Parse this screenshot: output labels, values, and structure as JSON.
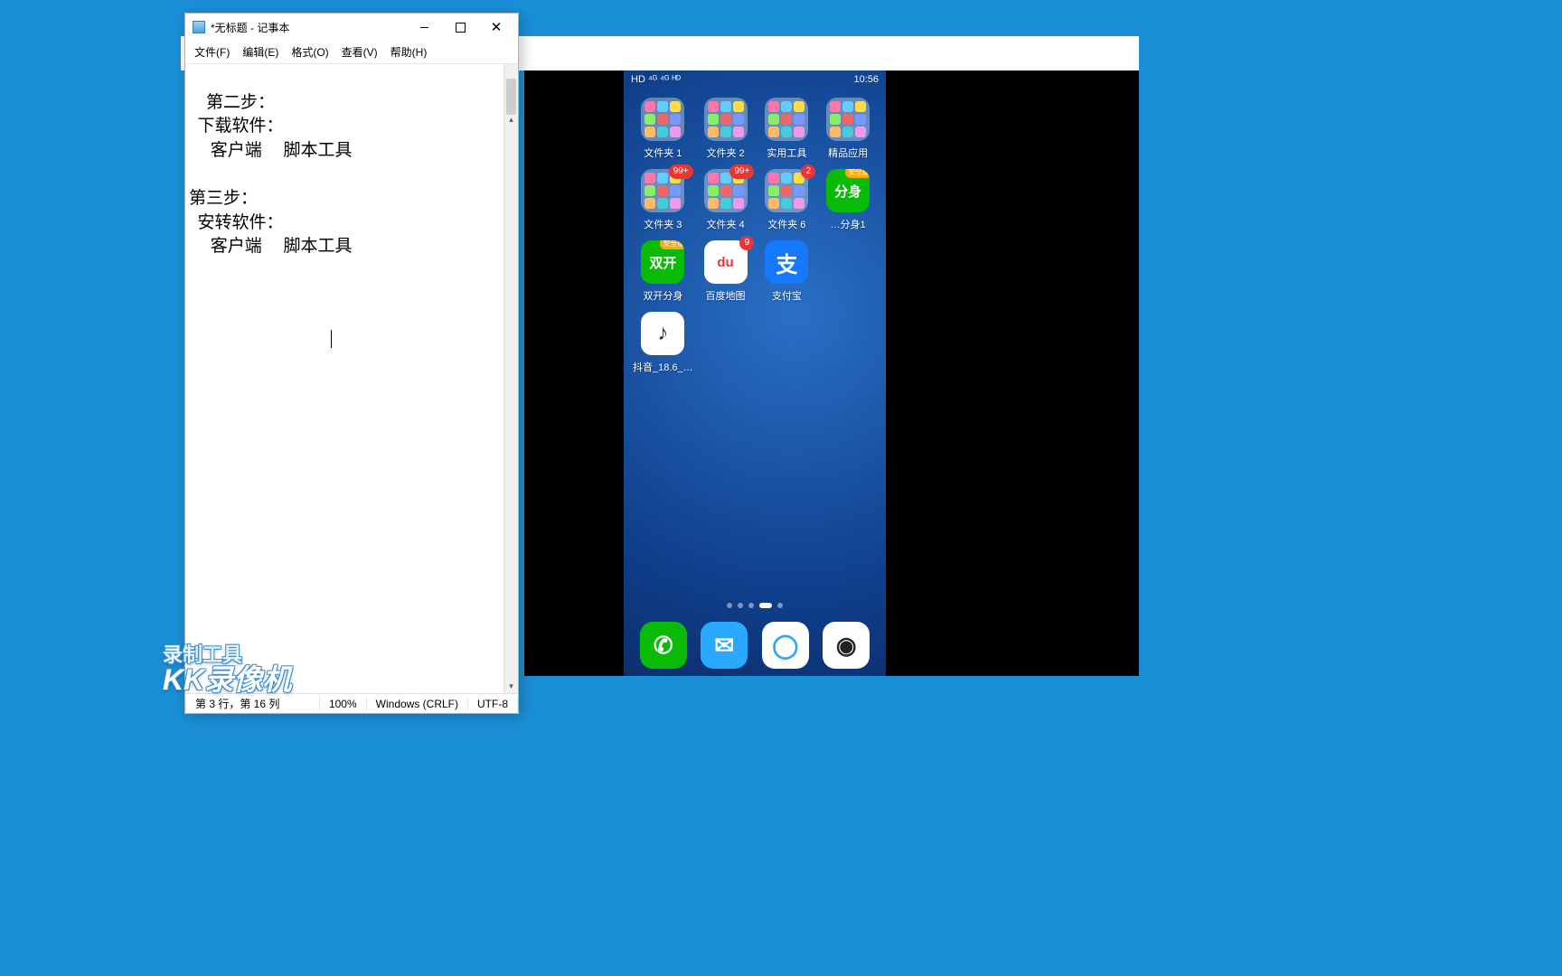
{
  "notepad": {
    "title": "*无标题 - 记事本",
    "menu": [
      "文件(F)",
      "编辑(E)",
      "格式(O)",
      "查看(V)",
      "帮助(H)"
    ],
    "content": "第二步：\n  下载软件：\n     客户端     脚本工具\n\n第三步：\n  安转软件：\n     客户端     脚本工具",
    "status": {
      "pos": "第 3 行，第 16 列",
      "zoom": "100%",
      "eol": "Windows (CRLF)",
      "enc": "UTF-8"
    }
  },
  "phone": {
    "status_left": "HD ⁴ᴳ ⁴ᴳ ᴴᴰ",
    "status_right": "10:56",
    "apps_row1": [
      {
        "label": "文件夹 1",
        "type": "folder"
      },
      {
        "label": "文件夹 2",
        "type": "folder"
      },
      {
        "label": "实用工具",
        "type": "folder"
      },
      {
        "label": "精品应用",
        "type": "folder"
      }
    ],
    "apps_row2": [
      {
        "label": "文件夹 3",
        "type": "folder",
        "badge": "99+"
      },
      {
        "label": "文件夹 4",
        "type": "folder",
        "badge": "99+"
      },
      {
        "label": "文件夹 6",
        "type": "folder",
        "badge": "2"
      },
      {
        "label": "…分身1",
        "type": "green",
        "glyph": "分身",
        "sub": "安全版"
      }
    ],
    "apps_row3": [
      {
        "label": "双开分身",
        "type": "green",
        "glyph": "双开",
        "sub": "安全版"
      },
      {
        "label": "百度地图",
        "type": "white",
        "glyph": "du",
        "glyphColor": "#e33",
        "badge": "9"
      },
      {
        "label": "支付宝",
        "type": "blue",
        "glyph": "支"
      }
    ],
    "apps_row4": [
      {
        "label": "抖音_18.6_…",
        "type": "white",
        "glyph": "♪"
      }
    ],
    "dock": [
      {
        "name": "phone",
        "bg": "#09bb07",
        "glyph": "✆"
      },
      {
        "name": "messages",
        "bg": "#2aa7ff",
        "glyph": "✉"
      },
      {
        "name": "browser",
        "bg": "#fff",
        "glyph": "◯",
        "glyphColor": "#2aa7ff"
      },
      {
        "name": "camera",
        "bg": "#fff",
        "glyph": "◉",
        "glyphColor": "#222"
      }
    ]
  },
  "watermark": {
    "line1": "录制工具",
    "line2": "KK录像机"
  }
}
